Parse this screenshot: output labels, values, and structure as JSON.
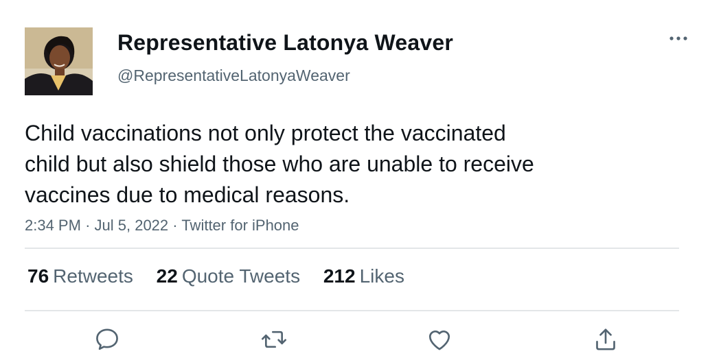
{
  "user": {
    "display_name": "Representative Latonya Weaver",
    "handle": "@RepresentativeLatonyaWeaver"
  },
  "tweet": {
    "lines": [
      "Child vaccinations not only protect the vaccinated",
      "child but also shield those who are unable to receive",
      "vaccines due to medical reasons."
    ],
    "time": "2:34 PM",
    "date": "Jul 5, 2022",
    "source": "Twitter for iPhone",
    "separator": "·"
  },
  "stats": {
    "retweets": {
      "count": "76",
      "label": "Retweets"
    },
    "quotes": {
      "count": "22",
      "label": "Quote Tweets"
    },
    "likes": {
      "count": "212",
      "label": "Likes"
    }
  },
  "actions": {
    "reply_icon": "reply-icon",
    "retweet_icon": "retweet-icon",
    "like_icon": "heart-icon",
    "share_icon": "share-icon"
  },
  "colors": {
    "text": "#0f1419",
    "secondary": "#536471",
    "divider": "#e3e6e8"
  }
}
